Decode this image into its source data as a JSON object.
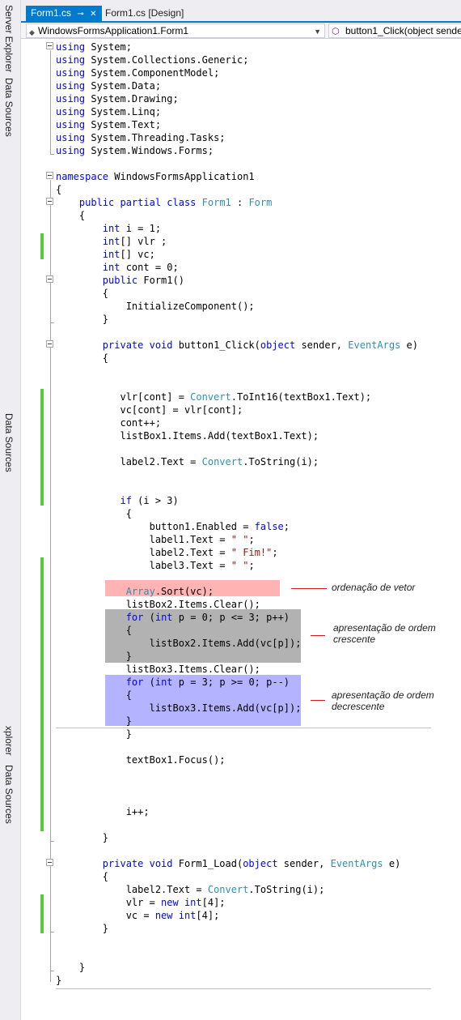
{
  "side_tabs": [
    "Server Explorer",
    "Data Sources",
    "Data Sources",
    "xplorer",
    "Data Sources"
  ],
  "tabs": {
    "active": "Form1.cs",
    "inactive": "Form1.cs [Design]"
  },
  "nav": {
    "class_combo": "WindowsFormsApplication1.Form1",
    "member_combo": "button1_Click(object sende"
  },
  "code": [
    [
      {
        "t": "kw",
        "v": "using"
      },
      {
        "t": "",
        "v": " System;"
      }
    ],
    [
      {
        "t": "kw",
        "v": "using"
      },
      {
        "t": "",
        "v": " System.Collections.Generic;"
      }
    ],
    [
      {
        "t": "kw",
        "v": "using"
      },
      {
        "t": "",
        "v": " System.ComponentModel;"
      }
    ],
    [
      {
        "t": "kw",
        "v": "using"
      },
      {
        "t": "",
        "v": " System.Data;"
      }
    ],
    [
      {
        "t": "kw",
        "v": "using"
      },
      {
        "t": "",
        "v": " System.Drawing;"
      }
    ],
    [
      {
        "t": "kw",
        "v": "using"
      },
      {
        "t": "",
        "v": " System.Linq;"
      }
    ],
    [
      {
        "t": "kw",
        "v": "using"
      },
      {
        "t": "",
        "v": " System.Text;"
      }
    ],
    [
      {
        "t": "kw",
        "v": "using"
      },
      {
        "t": "",
        "v": " System.Threading.Tasks;"
      }
    ],
    [
      {
        "t": "kw",
        "v": "using"
      },
      {
        "t": "",
        "v": " System.Windows.Forms;"
      }
    ],
    [],
    [
      {
        "t": "kw",
        "v": "namespace"
      },
      {
        "t": "",
        "v": " WindowsFormsApplication1"
      }
    ],
    [
      {
        "t": "",
        "v": "{"
      }
    ],
    [
      {
        "t": "",
        "v": "    "
      },
      {
        "t": "kw",
        "v": "public partial class"
      },
      {
        "t": "",
        "v": " "
      },
      {
        "t": "ty",
        "v": "Form1"
      },
      {
        "t": "",
        "v": " : "
      },
      {
        "t": "ty",
        "v": "Form"
      }
    ],
    [
      {
        "t": "",
        "v": "    {"
      }
    ],
    [
      {
        "t": "",
        "v": "        "
      },
      {
        "t": "kw",
        "v": "int"
      },
      {
        "t": "",
        "v": " i = 1;"
      }
    ],
    [
      {
        "t": "",
        "v": "        "
      },
      {
        "t": "kw",
        "v": "int"
      },
      {
        "t": "",
        "v": "[] vlr ;"
      }
    ],
    [
      {
        "t": "",
        "v": "        "
      },
      {
        "t": "kw",
        "v": "int"
      },
      {
        "t": "",
        "v": "[] vc;"
      }
    ],
    [
      {
        "t": "",
        "v": "        "
      },
      {
        "t": "kw",
        "v": "int"
      },
      {
        "t": "",
        "v": " cont = 0;"
      }
    ],
    [
      {
        "t": "",
        "v": "        "
      },
      {
        "t": "kw",
        "v": "public"
      },
      {
        "t": "",
        "v": " Form1()"
      }
    ],
    [
      {
        "t": "",
        "v": "        {"
      }
    ],
    [
      {
        "t": "",
        "v": "            InitializeComponent();"
      }
    ],
    [
      {
        "t": "",
        "v": "        }"
      }
    ],
    [],
    [
      {
        "t": "",
        "v": "        "
      },
      {
        "t": "kw",
        "v": "private void"
      },
      {
        "t": "",
        "v": " button1_Click("
      },
      {
        "t": "kw",
        "v": "object"
      },
      {
        "t": "",
        "v": " sender, "
      },
      {
        "t": "ty",
        "v": "EventArgs"
      },
      {
        "t": "",
        "v": " e)"
      }
    ],
    [
      {
        "t": "",
        "v": "        {"
      }
    ],
    [],
    [],
    [
      {
        "t": "",
        "v": "           vlr[cont] = "
      },
      {
        "t": "ty",
        "v": "Convert"
      },
      {
        "t": "",
        "v": ".ToInt16(textBox1.Text);"
      }
    ],
    [
      {
        "t": "",
        "v": "           vc[cont] = vlr[cont];"
      }
    ],
    [
      {
        "t": "",
        "v": "           cont++;"
      }
    ],
    [
      {
        "t": "",
        "v": "           listBox1.Items.Add(textBox1.Text);"
      }
    ],
    [],
    [
      {
        "t": "",
        "v": "           label2.Text = "
      },
      {
        "t": "ty",
        "v": "Convert"
      },
      {
        "t": "",
        "v": ".ToString(i);"
      }
    ],
    [],
    [],
    [
      {
        "t": "",
        "v": "           "
      },
      {
        "t": "kw",
        "v": "if"
      },
      {
        "t": "",
        "v": " (i > 3)"
      }
    ],
    [
      {
        "t": "",
        "v": "            {"
      }
    ],
    [
      {
        "t": "",
        "v": "                button1.Enabled = "
      },
      {
        "t": "kw",
        "v": "false"
      },
      {
        "t": "",
        "v": ";"
      }
    ],
    [
      {
        "t": "",
        "v": "                label1.Text = "
      },
      {
        "t": "str",
        "v": "\" \""
      },
      {
        "t": "",
        "v": ";"
      }
    ],
    [
      {
        "t": "",
        "v": "                label2.Text = "
      },
      {
        "t": "str",
        "v": "\" Fim!\""
      },
      {
        "t": "",
        "v": ";"
      }
    ],
    [
      {
        "t": "",
        "v": "                label3.Text = "
      },
      {
        "t": "str",
        "v": "\" \""
      },
      {
        "t": "",
        "v": ";"
      }
    ],
    [],
    [
      {
        "t": "",
        "v": "            "
      },
      {
        "t": "ty",
        "v": "Array"
      },
      {
        "t": "",
        "v": ".Sort(vc);"
      }
    ],
    [
      {
        "t": "",
        "v": "            listBox2.Items.Clear();"
      }
    ],
    [
      {
        "t": "",
        "v": "            "
      },
      {
        "t": "kw",
        "v": "for"
      },
      {
        "t": "",
        "v": " ("
      },
      {
        "t": "kw",
        "v": "int"
      },
      {
        "t": "",
        "v": " p = 0; p <= 3; p++)"
      }
    ],
    [
      {
        "t": "",
        "v": "            {"
      }
    ],
    [
      {
        "t": "",
        "v": "                listBox2.Items.Add(vc[p]);"
      }
    ],
    [
      {
        "t": "",
        "v": "            }"
      }
    ],
    [
      {
        "t": "",
        "v": "            listBox3.Items.Clear();"
      }
    ],
    [
      {
        "t": "",
        "v": "            "
      },
      {
        "t": "kw",
        "v": "for"
      },
      {
        "t": "",
        "v": " ("
      },
      {
        "t": "kw",
        "v": "int"
      },
      {
        "t": "",
        "v": " p = 3; p >= 0; p--)"
      }
    ],
    [
      {
        "t": "",
        "v": "            {"
      }
    ],
    [
      {
        "t": "",
        "v": "                listBox3.Items.Add(vc[p]);"
      }
    ],
    [
      {
        "t": "",
        "v": "            }"
      }
    ],
    [
      {
        "t": "",
        "v": "            }"
      }
    ],
    [],
    [
      {
        "t": "",
        "v": "            textBox1.Focus();"
      }
    ],
    [],
    [],
    [],
    [
      {
        "t": "",
        "v": "            i++;"
      }
    ],
    [],
    [
      {
        "t": "",
        "v": "        }"
      }
    ],
    [],
    [
      {
        "t": "",
        "v": "        "
      },
      {
        "t": "kw",
        "v": "private void"
      },
      {
        "t": "",
        "v": " Form1_Load("
      },
      {
        "t": "kw",
        "v": "object"
      },
      {
        "t": "",
        "v": " sender, "
      },
      {
        "t": "ty",
        "v": "EventArgs"
      },
      {
        "t": "",
        "v": " e)"
      }
    ],
    [
      {
        "t": "",
        "v": "        {"
      }
    ],
    [
      {
        "t": "",
        "v": "            label2.Text = "
      },
      {
        "t": "ty",
        "v": "Convert"
      },
      {
        "t": "",
        "v": ".ToString(i);"
      }
    ],
    [
      {
        "t": "",
        "v": "            vlr = "
      },
      {
        "t": "kw",
        "v": "new int"
      },
      {
        "t": "",
        "v": "[4];"
      }
    ],
    [
      {
        "t": "",
        "v": "            vc = "
      },
      {
        "t": "kw",
        "v": "new int"
      },
      {
        "t": "",
        "v": "[4];"
      }
    ],
    [
      {
        "t": "",
        "v": "        }"
      }
    ],
    [],
    [],
    [
      {
        "t": "",
        "v": "    }"
      }
    ],
    [
      {
        "t": "",
        "v": "}"
      }
    ]
  ],
  "annotations": {
    "sort": "ordenação de vetor",
    "asc_1": "apresentação de ordem",
    "asc_2": "crescente",
    "desc_1": "apresentação de ordem",
    "desc_2": "decrescente"
  },
  "colors": {
    "keyword": "#0000ff",
    "type": "#2b91af",
    "string": "#a31515",
    "sort_highlight": "#ffb3b3",
    "asc_highlight": "#b2b2b2",
    "desc_highlight": "#b3b3ff",
    "change_bar": "#57c93a",
    "accent": "#007acc"
  }
}
